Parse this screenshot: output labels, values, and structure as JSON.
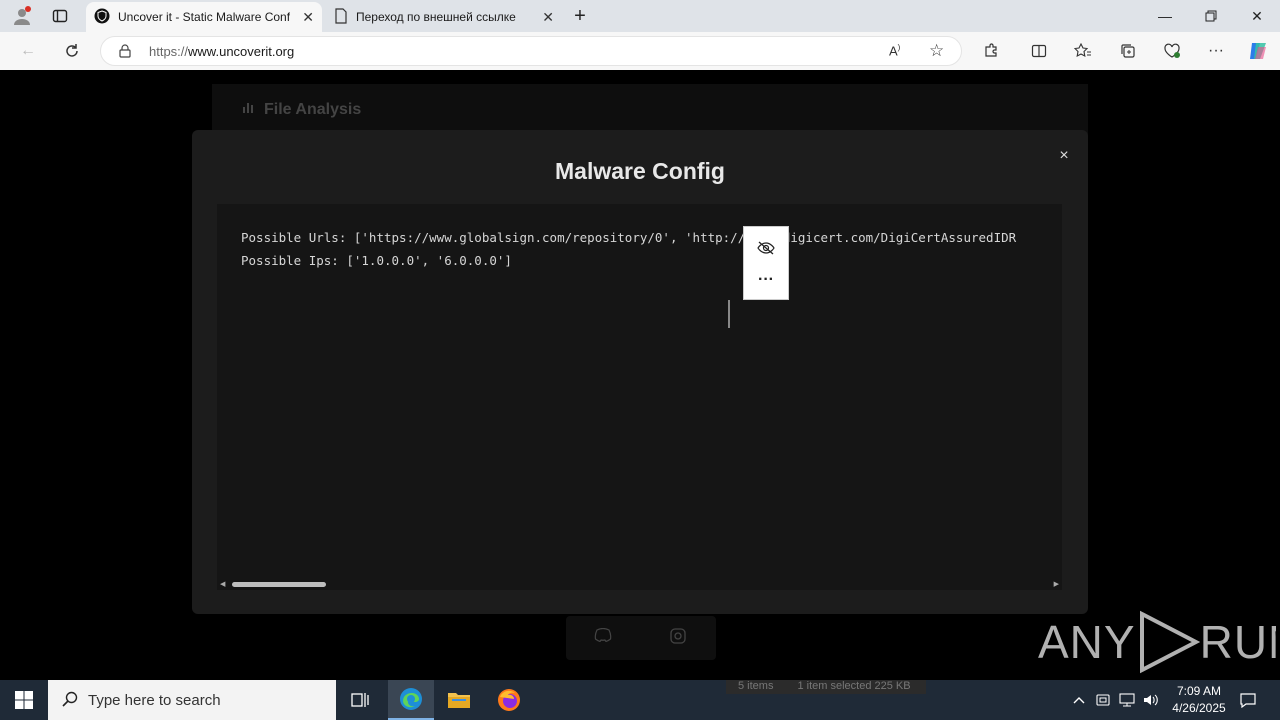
{
  "browser": {
    "tabs": [
      {
        "title": "Uncover it - Static Malware Config",
        "active": true
      },
      {
        "title": "Переход по внешней ссылке",
        "active": false
      }
    ],
    "address": {
      "url_prefix": "https://",
      "url_host": "www.uncoverit.org"
    }
  },
  "page": {
    "bg_heading": "File Analysis",
    "modal": {
      "title": "Malware Config",
      "close_glyph": "×",
      "lines": [
        "Possible Urls: ['https://www.globalsign.com/repository/0', 'http://crl3.digicert.com/DigiCertAssuredIDR",
        "Possible Ips: ['1.0.0.0', '6.0.0.0']"
      ]
    },
    "mini_toolbar": {
      "more_glyph": "···"
    }
  },
  "watermark": {
    "text_left": "ANY",
    "text_right": "RUN"
  },
  "taskbar": {
    "search_placeholder": "Type here to search",
    "explorer_status": {
      "items": "5 items",
      "selected": "1 item selected  225 KB"
    },
    "clock": {
      "time": "7:09 AM",
      "date": "4/26/2025"
    }
  },
  "colors": {
    "accent": "#0078d4",
    "modal_bg": "#1c1c1c",
    "page_bg": "#000000",
    "taskbar_bg": "#1f2a37"
  }
}
